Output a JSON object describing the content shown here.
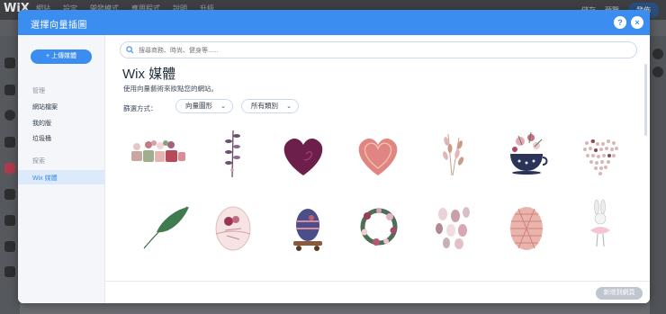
{
  "editor": {
    "logo": "WiX",
    "menu": [
      "網站",
      "設定",
      "開發模式",
      "應用程式",
      "說明",
      "升級"
    ],
    "save": "儲存",
    "preview": "預覽",
    "publish": "發佈"
  },
  "modal": {
    "title": "選擇向量插圖",
    "help_label": "?",
    "close_label": "×",
    "upload_button": "+ 上傳媒體",
    "nav": {
      "manage_label": "管理",
      "items": [
        "網站檔案",
        "我的版",
        "垃圾桶"
      ],
      "explore_label": "探索",
      "selected": "Wix 媒體"
    },
    "search": {
      "placeholder": "搜尋商務、時尚、健身等......"
    },
    "heading": "Wix 媒體",
    "subtitle": "使用向量藝術來妝點您的網站。",
    "filter": {
      "label": "篩選方式：",
      "type_value": "向量圖形",
      "category_value": "所有類別"
    },
    "footer": {
      "add_button": "新增到網頁"
    },
    "gallery": [
      "easter-basket-illustration",
      "lavender-sprig-illustration",
      "purple-heart-illustration",
      "pink-heart-illustration",
      "wheat-stalks-illustration",
      "flower-teacup-illustration",
      "dotted-heart-illustration",
      "green-leaf-illustration",
      "decorated-easter-egg-illustration",
      "egg-on-cart-illustration",
      "flower-wreath-illustration",
      "scattered-eggs-illustration",
      "patterned-pink-egg-illustration",
      "bunny-ballerina-illustration"
    ]
  }
}
